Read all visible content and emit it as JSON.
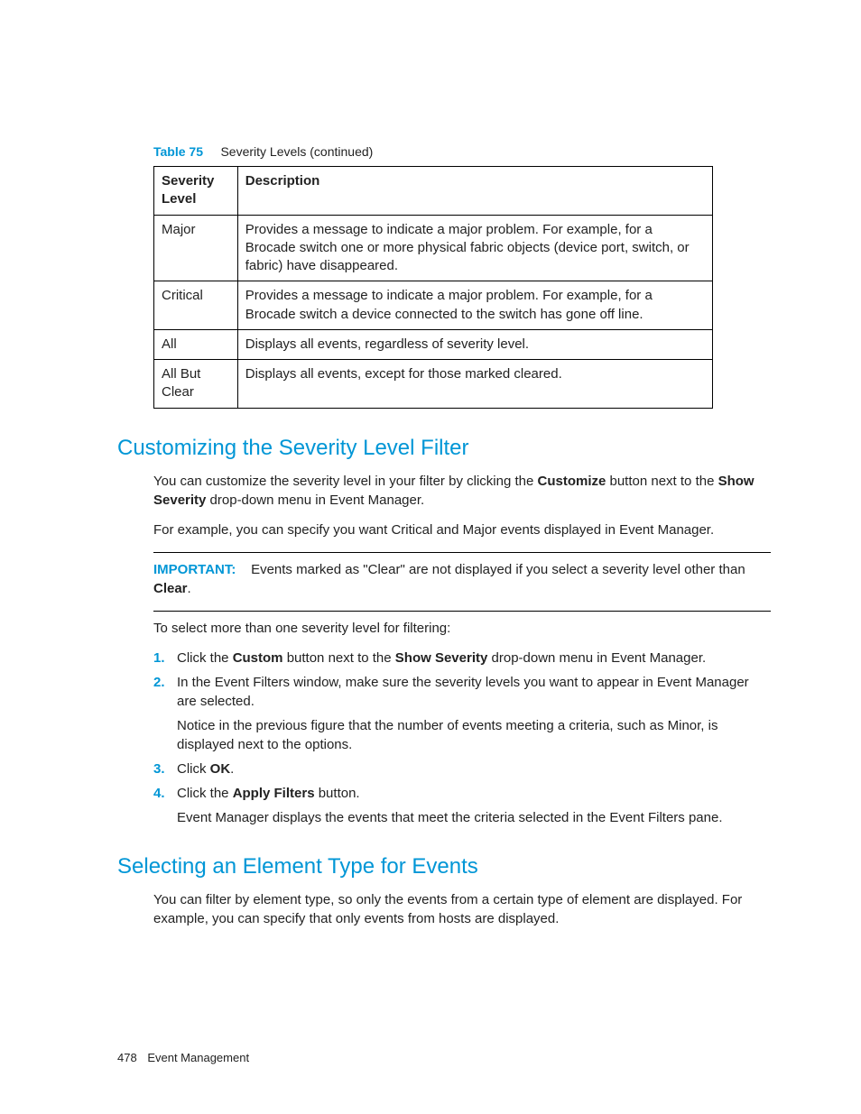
{
  "table": {
    "label": "Table 75",
    "caption": "Severity Levels (continued)",
    "headers": {
      "col1": "Severity Level",
      "col2": "Description"
    },
    "rows": [
      {
        "level": "Major",
        "desc": "Provides a message to indicate a major problem. For example, for a Brocade switch one or more physical fabric objects (device port, switch, or fabric) have disappeared."
      },
      {
        "level": "Critical",
        "desc": "Provides a message to indicate a major problem. For example, for a Brocade switch a device connected to the switch has gone off line."
      },
      {
        "level": "All",
        "desc": "Displays all events, regardless of severity level."
      },
      {
        "level": "All But Clear",
        "desc": "Displays all events, except for those marked cleared."
      }
    ]
  },
  "section1": {
    "heading": "Customizing the Severity Level Filter",
    "p1_pre": "You can customize the severity level in your filter by clicking the ",
    "p1_b1": "Customize",
    "p1_mid": " button next to the ",
    "p1_b2": "Show Severity",
    "p1_post": " drop-down menu in Event Manager.",
    "p2": "For example, you can specify you want Critical and Major events displayed in Event Manager.",
    "important_label": "IMPORTANT:",
    "important_text_pre": "Events marked as \"Clear\" are not displayed if you select a severity level other than ",
    "important_bold": "Clear",
    "important_text_post": ".",
    "p3": "To select more than one severity level for filtering:",
    "steps": [
      {
        "num": "1.",
        "pre": "Click the ",
        "b1": "Custom",
        "mid": " button next to the ",
        "b2": "Show Severity",
        "post": " drop-down menu in Event Manager."
      },
      {
        "num": "2.",
        "pre": "In the Event Filters window, make sure the severity levels you want to appear in Event Manager are selected.",
        "b1": "",
        "mid": "",
        "b2": "",
        "post": "",
        "note": "Notice in the previous figure that the number of events meeting a criteria, such as Minor, is displayed next to the options."
      },
      {
        "num": "3.",
        "pre": "Click ",
        "b1": "OK",
        "mid": "",
        "b2": "",
        "post": "."
      },
      {
        "num": "4.",
        "pre": "Click the ",
        "b1": "Apply Filters",
        "mid": "",
        "b2": "",
        "post": " button.",
        "note": "Event Manager displays the events that meet the criteria selected in the Event Filters pane."
      }
    ]
  },
  "section2": {
    "heading": "Selecting an Element Type for Events",
    "p1": "You can filter by element type, so only the events from a certain type of element are displayed. For example, you can specify that only events from hosts are displayed."
  },
  "footer": {
    "page": "478",
    "title": "Event Management"
  }
}
